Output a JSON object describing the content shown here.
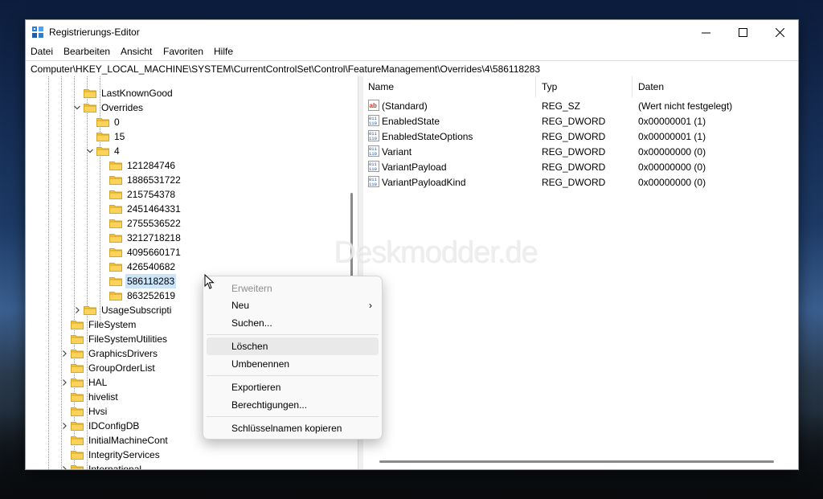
{
  "window": {
    "title": "Registrierungs-Editor",
    "controls": {
      "minimize": "—",
      "maximize": "☐",
      "close": "✕"
    }
  },
  "menu": [
    "Datei",
    "Bearbeiten",
    "Ansicht",
    "Favoriten",
    "Hilfe"
  ],
  "address": "Computer\\HKEY_LOCAL_MACHINE\\SYSTEM\\CurrentControlSet\\Control\\FeatureManagement\\Overrides\\4\\586118283",
  "tree": [
    {
      "label": "LastKnownGood"
    },
    {
      "label": "Overrides",
      "expanded": true
    },
    {
      "label": "0"
    },
    {
      "label": "15"
    },
    {
      "label": "4",
      "expanded": true
    },
    {
      "label": "121284746"
    },
    {
      "label": "1886531722"
    },
    {
      "label": "215754378"
    },
    {
      "label": "2451464331"
    },
    {
      "label": "2755536522"
    },
    {
      "label": "3212718218"
    },
    {
      "label": "4095660171"
    },
    {
      "label": "426540682"
    },
    {
      "label": "586118283",
      "selected": true
    },
    {
      "label": "863252619"
    },
    {
      "label": "UsageSubscripti",
      "expandable": true
    },
    {
      "label": "FileSystem"
    },
    {
      "label": "FileSystemUtilities"
    },
    {
      "label": "GraphicsDrivers",
      "expandable": true
    },
    {
      "label": "GroupOrderList"
    },
    {
      "label": "HAL",
      "expandable": true
    },
    {
      "label": "hivelist"
    },
    {
      "label": "Hvsi"
    },
    {
      "label": "IDConfigDB",
      "expandable": true
    },
    {
      "label": "InitialMachineCont"
    },
    {
      "label": "IntegrityServices"
    },
    {
      "label": "International",
      "expandable": true
    }
  ],
  "values": {
    "columns": {
      "name": "Name",
      "type": "Typ",
      "data": "Daten"
    },
    "rows": [
      {
        "name": "(Standard)",
        "type": "REG_SZ",
        "data": "(Wert nicht festgelegt)",
        "icon": "string-value-icon"
      },
      {
        "name": "EnabledState",
        "type": "REG_DWORD",
        "data": "0x00000001 (1)",
        "icon": "binary-value-icon"
      },
      {
        "name": "EnabledStateOptions",
        "type": "REG_DWORD",
        "data": "0x00000001 (1)",
        "icon": "binary-value-icon"
      },
      {
        "name": "Variant",
        "type": "REG_DWORD",
        "data": "0x00000000 (0)",
        "icon": "binary-value-icon"
      },
      {
        "name": "VariantPayload",
        "type": "REG_DWORD",
        "data": "0x00000000 (0)",
        "icon": "binary-value-icon"
      },
      {
        "name": "VariantPayloadKind",
        "type": "REG_DWORD",
        "data": "0x00000000 (0)",
        "icon": "binary-value-icon"
      }
    ]
  },
  "watermark": "Deskmodder.de",
  "context_menu": {
    "items": [
      {
        "label": "Erweitern",
        "disabled": true
      },
      {
        "label": "Neu",
        "submenu_arrow": "›"
      },
      {
        "label": "Suchen..."
      },
      {
        "label": "Löschen",
        "hover": true
      },
      {
        "label": "Umbenennen"
      },
      {
        "label": "Exportieren"
      },
      {
        "label": "Berechtigungen..."
      },
      {
        "label": "Schlüsselnamen kopieren"
      }
    ]
  },
  "colors": {
    "selection": "#cce4f7",
    "folder": "#f5c542",
    "menu_bg": "#f9f9f9"
  }
}
